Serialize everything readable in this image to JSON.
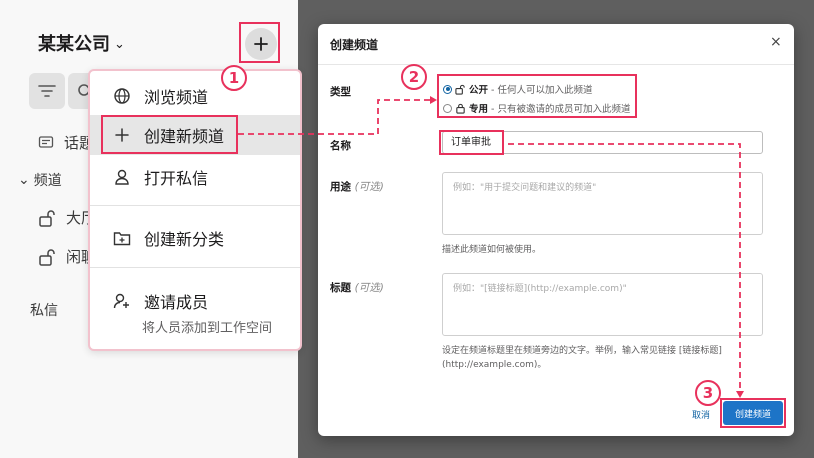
{
  "sidebar": {
    "workspace_name": "某某公司",
    "workspace_chevron": "⌄",
    "topics_label": "话题",
    "channels_header": "频道",
    "channels_chevron": "⌄",
    "channels": [
      "大厅",
      "闲聊"
    ],
    "dm_header": "私信"
  },
  "menu": {
    "items": [
      {
        "label": "浏览频道",
        "icon": "globe-icon"
      },
      {
        "label": "创建新频道",
        "icon": "plus-icon"
      },
      {
        "label": "打开私信",
        "icon": "person-icon"
      },
      {
        "label": "创建新分类",
        "icon": "folder-plus-icon"
      },
      {
        "label": "邀请成员",
        "icon": "add-person-icon"
      }
    ],
    "invite_subtext": "将人员添加到工作空间"
  },
  "steps": [
    "1",
    "2",
    "3"
  ],
  "dialog": {
    "title": "创建频道",
    "close_label": "×",
    "type_label": "类型",
    "public_title": "公开",
    "public_desc": " - 任何人可以加入此频道",
    "public_selected": true,
    "private_title": "专用",
    "private_desc": " - 只有被邀请的成员可加入此频道",
    "name_label": "名称",
    "name_value": "订单审批",
    "purpose_label": "用途",
    "optional_tag": "(可选)",
    "purpose_placeholder": "例如：\"用于提交问题和建议的频道\"",
    "purpose_hint": "描述此频道如何被使用。",
    "topic_label": "标题",
    "topic_placeholder": "例如：\"[链接标题](http://example.com)\"",
    "topic_hint": "设定在频道标题里在频道旁边的文字。举例，输入常见链接 [链接标题](http://example.com)。",
    "cancel_label": "取消",
    "create_label": "创建频道"
  },
  "colors": {
    "annotation": "#e8315c",
    "primary": "#1d74c7",
    "link": "#1264a3"
  }
}
